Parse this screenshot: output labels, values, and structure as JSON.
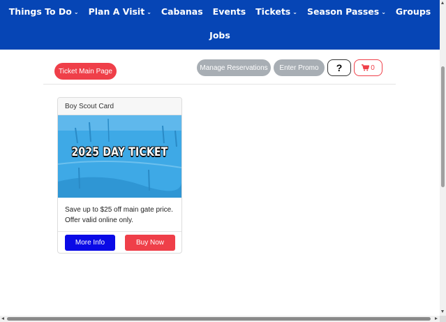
{
  "nav": {
    "items": [
      {
        "label": "Things To Do",
        "has_dropdown": true
      },
      {
        "label": "Plan A Visit",
        "has_dropdown": true
      },
      {
        "label": "Cabanas",
        "has_dropdown": false
      },
      {
        "label": "Events",
        "has_dropdown": false
      },
      {
        "label": "Tickets",
        "has_dropdown": true
      },
      {
        "label": "Season Passes",
        "has_dropdown": true
      },
      {
        "label": "Groups",
        "has_dropdown": false
      }
    ],
    "second_row": {
      "label": "Jobs"
    },
    "dropdown_icon": "chevron-down-icon"
  },
  "actions": {
    "ticket_main_page": "Ticket Main Page",
    "manage_reservations": "Manage Reservations",
    "enter_promo": "Enter Promo",
    "help": "?",
    "cart_count": "0",
    "cart_icon": "shopping-cart-icon"
  },
  "card": {
    "title": "Boy Scout Card",
    "image_text": "2025 DAY TICKET",
    "description": "Save up to $25 off main gate price. Offer valid online only.",
    "more_info": "More Info",
    "buy_now": "Buy Now"
  },
  "colors": {
    "nav_bg": "#0645b5",
    "primary_red": "#ef3f49",
    "secondary_gray": "#a8aeb4",
    "more_info_blue": "#0a0ae6",
    "image_blue": "#3ea9e6"
  }
}
